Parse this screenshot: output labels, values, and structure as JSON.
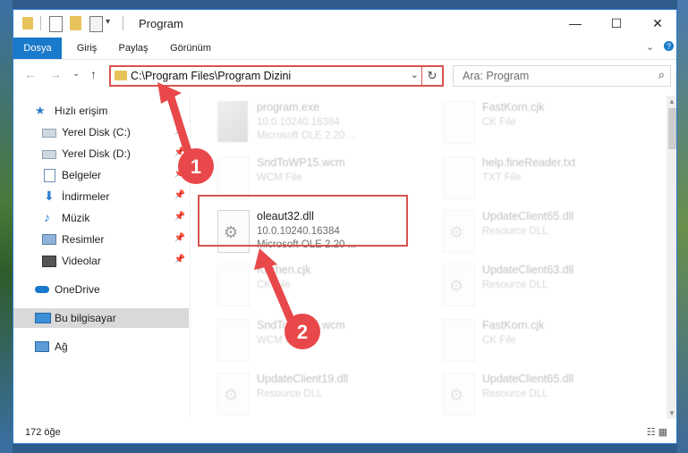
{
  "window": {
    "title": "Program",
    "minimize": "—",
    "maximize": "☐",
    "close": "✕"
  },
  "ribbon": {
    "tabs": [
      "Dosya",
      "Giriş",
      "Paylaş",
      "Görünüm"
    ],
    "expand": "⌄",
    "help": "?"
  },
  "nav": {
    "back": "←",
    "forward": "→",
    "recent": "⌄",
    "up": "↑",
    "address": "C:\\Program Files\\Program Dizini",
    "dropdown": "⌄",
    "refresh": "↻",
    "search_placeholder": "Ara: Program",
    "search_icon": "⌕"
  },
  "sidebar": {
    "items": [
      {
        "label": "Hızlı erişim",
        "icon": "star-icon"
      },
      {
        "label": "Yerel Disk (C:)",
        "icon": "drive-icon"
      },
      {
        "label": "Yerel Disk (D:)",
        "icon": "drive-icon"
      },
      {
        "label": "Belgeler",
        "icon": "documents-icon"
      },
      {
        "label": "İndirmeler",
        "icon": "download-icon"
      },
      {
        "label": "Müzik",
        "icon": "music-icon"
      },
      {
        "label": "Resimler",
        "icon": "pictures-icon"
      },
      {
        "label": "Videolar",
        "icon": "videos-icon"
      },
      {
        "label": "OneDrive",
        "icon": "cloud-icon"
      },
      {
        "label": "Bu bilgisayar",
        "icon": "computer-icon"
      },
      {
        "label": "Ağ",
        "icon": "network-icon"
      }
    ],
    "pin": "📌"
  },
  "files": {
    "left": [
      {
        "name": "program.exe",
        "l2": "10.0.10240.16384",
        "l3": "Microsoft OLE 2.20 ..."
      },
      {
        "name": "SndToWP15.wcm",
        "l2": "WCM File",
        "l3": ""
      },
      {
        "name": "oleaut32.dll",
        "l2": "10.0.10240.16384",
        "l3": "Microsoft OLE 2.20 ..."
      },
      {
        "name": "Kitchen.cjk",
        "l2": "CK File",
        "l3": ""
      },
      {
        "name": "SndToWP15.wcm",
        "l2": "WCM File",
        "l3": ""
      },
      {
        "name": "UpdateClient19.dll",
        "l2": "Resource DLL",
        "l3": ""
      }
    ],
    "right": [
      {
        "name": "FastKorn.cjk",
        "l2": "CK File"
      },
      {
        "name": "help.fineReader.txt",
        "l2": "TXT File"
      },
      {
        "name": "UpdateClient65.dll",
        "l2": "Resource DLL"
      },
      {
        "name": "UpdateClient63.dll",
        "l2": "Resource DLL"
      },
      {
        "name": "FastKorn.cjk",
        "l2": "CK File"
      },
      {
        "name": "UpdateClient65.dll",
        "l2": "Resource DLL"
      }
    ]
  },
  "annotations": {
    "step1": "1",
    "step2": "2",
    "color": "#e8484a"
  },
  "status": {
    "count": "172 öğe",
    "views": "☷ ▦"
  }
}
